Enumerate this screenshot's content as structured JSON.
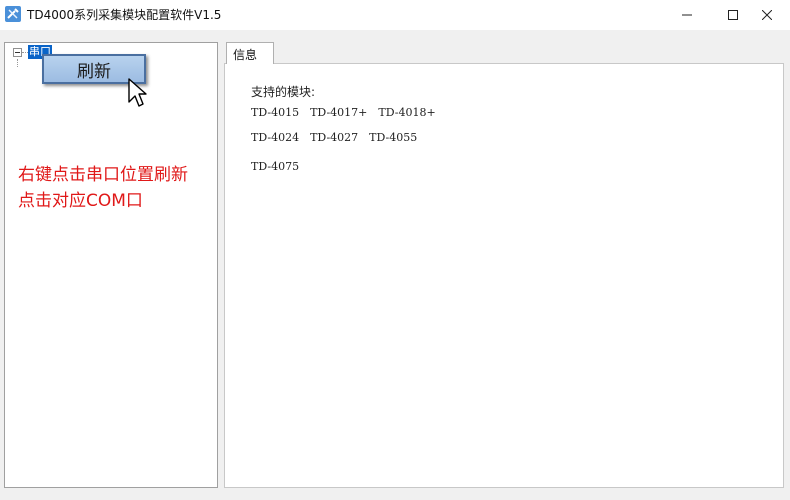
{
  "app": {
    "title": "TD4000系列采集模块配置软件V1.5",
    "icon": "tools-icon"
  },
  "window_controls": {
    "minimize": "minimize-icon",
    "maximize": "maximize-icon",
    "close": "close-icon"
  },
  "tree": {
    "root_label": "串口"
  },
  "context_menu": {
    "items": [
      {
        "label": "刷新"
      }
    ]
  },
  "annotation": {
    "line1": "右键点击串口位置刷新",
    "line2": "点击对应COM口",
    "color": "#e01818"
  },
  "tabs": [
    {
      "label": "信息"
    }
  ],
  "info": {
    "heading": "支持的模块:",
    "rows": [
      [
        "TD-4015",
        "TD-4017+",
        "TD-4018+"
      ],
      [
        "TD-4024",
        "TD-4027",
        "TD-4055"
      ],
      [
        "TD-4075"
      ]
    ]
  },
  "colors": {
    "selection": "#0a64c8",
    "menu_background": "#b8d2ee",
    "annotation": "#e01818"
  }
}
